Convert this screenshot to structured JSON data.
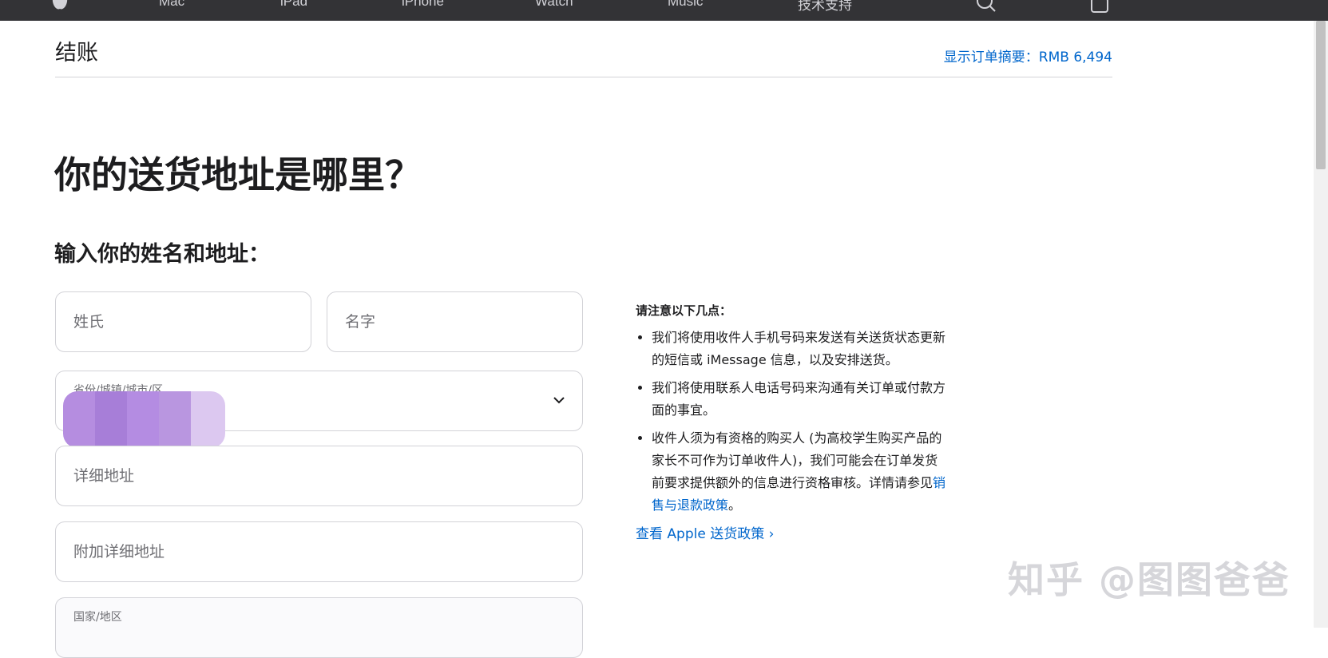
{
  "nav": {
    "items": [
      "Mac",
      "iPad",
      "iPhone",
      "Watch",
      "Music",
      "技术支持"
    ],
    "icons": [
      "apple-logo-icon",
      "search-icon",
      "bag-icon"
    ]
  },
  "header": {
    "title": "结账",
    "order_summary": "显示订单摘要：RMB 6,494"
  },
  "main": {
    "heading": "你的送货地址是哪里？",
    "subheading": "输入你的姓名和地址："
  },
  "form": {
    "last_name_placeholder": "姓氏",
    "first_name_placeholder": "名字",
    "region_label": "省份/城镇/城市/区",
    "address_placeholder": "详细地址",
    "address2_placeholder": "附加详细地址",
    "country_label": "国家/地区"
  },
  "notes": {
    "title": "请注意以下几点：",
    "item1": "我们将使用收件人手机号码来发送有关送货状态更新的短信或 iMessage 信息，以及安排送货。",
    "item2": "我们将使用联系人电话号码来沟通有关订单或付款方面的事宜。",
    "item3_text": "收件人须为有资格的购买人 (为高校学生购买产品的家长不可作为订单收件人)，我们可能会在订单发货前要求提供额外的信息进行资格审核。详情请参见",
    "item3_link": "销售与退款政策",
    "item3_end": "。",
    "shipping_link": "查看 Apple 送货政策 ›"
  },
  "watermark": "知乎 @图图爸爸",
  "colors": {
    "link": "#0066cc",
    "nav_bg": "#333336",
    "border": "#d2d2d7",
    "text": "#1d1d1f",
    "placeholder": "#6e6e73"
  }
}
